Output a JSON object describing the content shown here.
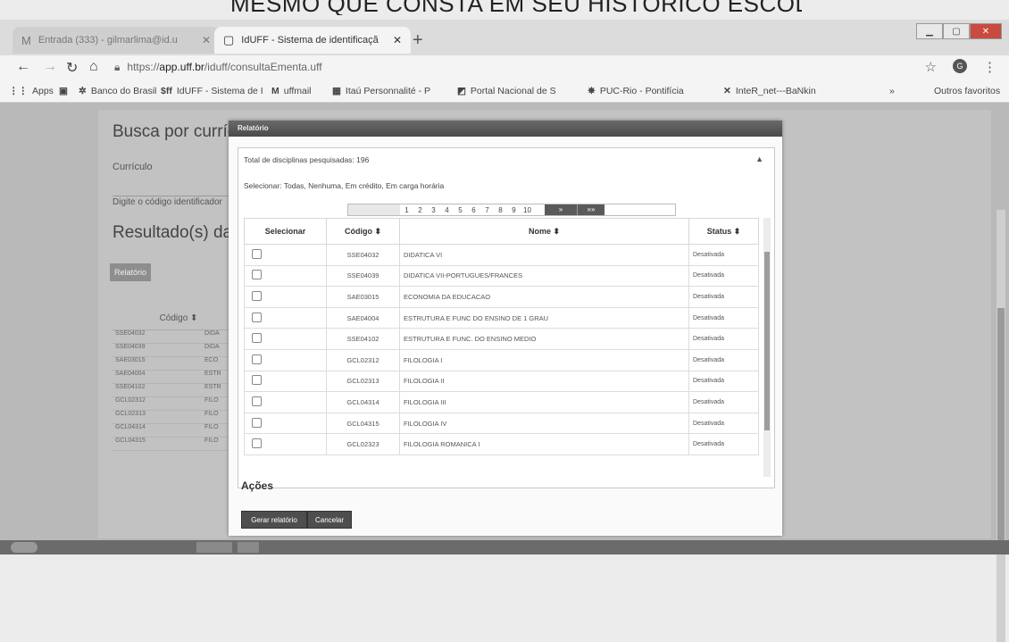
{
  "caption": "MESMO QUE CONSTA EM SEU HISTÓRICO ESCOLAR)",
  "browser": {
    "tabs": [
      {
        "label": "Entrada (333) - gilmarlima@id.u",
        "icon": "M"
      },
      {
        "label": "IdUFF - Sistema de identificaçã",
        "icon": "▢"
      }
    ],
    "url_scheme": "https://",
    "url_host": "app.uff.br",
    "url_path": "/iduff/consultaEmenta.uff",
    "bookmarks": [
      {
        "label": "Apps",
        "icon": "⋮⋮"
      },
      {
        "label": "",
        "icon": "▣"
      },
      {
        "label": "Banco do Brasil",
        "icon": "✲"
      },
      {
        "label": "IdUFF - Sistema de I",
        "icon": "$ff"
      },
      {
        "label": "uffmail",
        "icon": "M"
      },
      {
        "label": "Itaú Personnalité - P",
        "icon": "▦"
      },
      {
        "label": "Portal Nacional de S",
        "icon": "◩"
      },
      {
        "label": "PUC-Rio - Pontifícia",
        "icon": "✵"
      },
      {
        "label": "InteR_net---BaNkin",
        "icon": "✕"
      },
      {
        "label": "»",
        "icon": ""
      },
      {
        "label": "Outros favoritos",
        "icon": ""
      }
    ],
    "avatar_letter": "G"
  },
  "background_page": {
    "title": "Busca por currículo",
    "field_label": "Currículo",
    "hint": "Digite o código identificador",
    "results_title": "Resultado(s) da",
    "button": "Relatório",
    "table_header": "Código ⬍",
    "rows": [
      {
        "code": "SSE04032",
        "name": "DIDA"
      },
      {
        "code": "SSE04039",
        "name": "DIDA"
      },
      {
        "code": "SAE03015",
        "name": "ECO"
      },
      {
        "code": "SAE04004",
        "name": "ESTR"
      },
      {
        "code": "SSE04102",
        "name": "ESTR"
      },
      {
        "code": "GCL02312",
        "name": "FILO"
      },
      {
        "code": "GCL02313",
        "name": "FILO"
      },
      {
        "code": "GCL04314",
        "name": "FILO"
      },
      {
        "code": "GCL04315",
        "name": "FILO"
      }
    ]
  },
  "modal": {
    "title": "Relatório",
    "total": "Total de disciplinas pesquisadas: 196",
    "select_links": "Selecionar: Todas, Nenhuma, Em crédito, Em carga horária",
    "pages": [
      "1",
      "2",
      "3",
      "4",
      "5",
      "6",
      "7",
      "8",
      "9",
      "10"
    ],
    "next": "»",
    "last": "»»",
    "columns": {
      "select": "Selecionar",
      "code": "Código ⬍",
      "name": "Nome ⬍",
      "status": "Status ⬍"
    },
    "rows": [
      {
        "code": "SSE04032",
        "name": "DIDATICA VI",
        "status": "Desativada"
      },
      {
        "code": "SSE04039",
        "name": "DIDATICA VII-PORTUGUES/FRANCES",
        "status": "Desativada"
      },
      {
        "code": "SAE03015",
        "name": "ECONOMIA DA EDUCACAO",
        "status": "Desativada"
      },
      {
        "code": "SAE04004",
        "name": "ESTRUTURA E FUNC DO ENSINO DE 1 GRAU",
        "status": "Desativada"
      },
      {
        "code": "SSE04102",
        "name": "ESTRUTURA E FUNC. DO ENSINO MEDIO",
        "status": "Desativada"
      },
      {
        "code": "GCL02312",
        "name": "FILOLOGIA I",
        "status": "Desativada"
      },
      {
        "code": "GCL02313",
        "name": "FILOLOGIA II",
        "status": "Desativada"
      },
      {
        "code": "GCL04314",
        "name": "FILOLOGIA III",
        "status": "Desativada"
      },
      {
        "code": "GCL04315",
        "name": "FILOLOGIA IV",
        "status": "Desativada"
      },
      {
        "code": "GCL02323",
        "name": "FILOLOGIA ROMANICA I",
        "status": "Desativada"
      }
    ],
    "actions_title": "Ações",
    "generate_button": "Gerar relatório",
    "cancel_button": "Cancelar"
  }
}
